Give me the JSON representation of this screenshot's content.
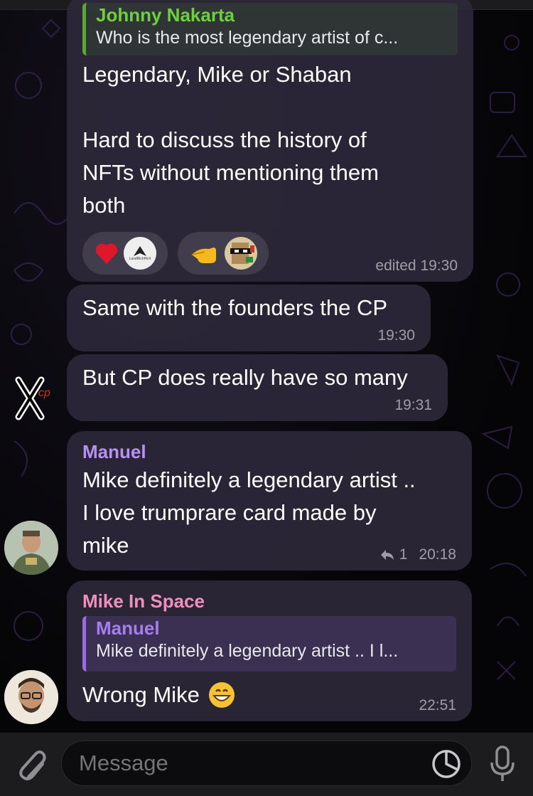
{
  "messages": {
    "m1": {
      "reply": {
        "name": "Johnny Nakarta",
        "text": "Who is the most legendary artist of c..."
      },
      "text": "Legendary, Mike or Shaban\n\nHard to discuss the history of\nNFTs without mentioning them\nboth",
      "reactions": [
        {
          "emoji": "heart",
          "user": "LandRichHeX"
        },
        {
          "emoji": "pointing-hand",
          "user": "pixel-avatar"
        }
      ],
      "reaction_user_label": "LandRichHeX",
      "time": "edited 19:30"
    },
    "m2": {
      "text": "Same with the founders the CP",
      "time": "19:30"
    },
    "m3": {
      "text": "But CP does really have so many",
      "time": "19:31",
      "avatar_label": "cp"
    },
    "m4": {
      "sender": "Manuel",
      "sender_color": "#b892f2",
      "text": "Mike definitely a legendary artist ..\nI love trumprare card made by\nmike",
      "reply_count": "1",
      "time": "20:18"
    },
    "m5": {
      "sender": "Mike In Space",
      "sender_color": "#f08fbf",
      "reply": {
        "name": "Manuel",
        "text": "Mike definitely a legendary artist .. I l..."
      },
      "text": "Wrong Mike",
      "emoji": "grinning-face",
      "time": "22:51"
    }
  },
  "composer": {
    "placeholder": "Message"
  }
}
